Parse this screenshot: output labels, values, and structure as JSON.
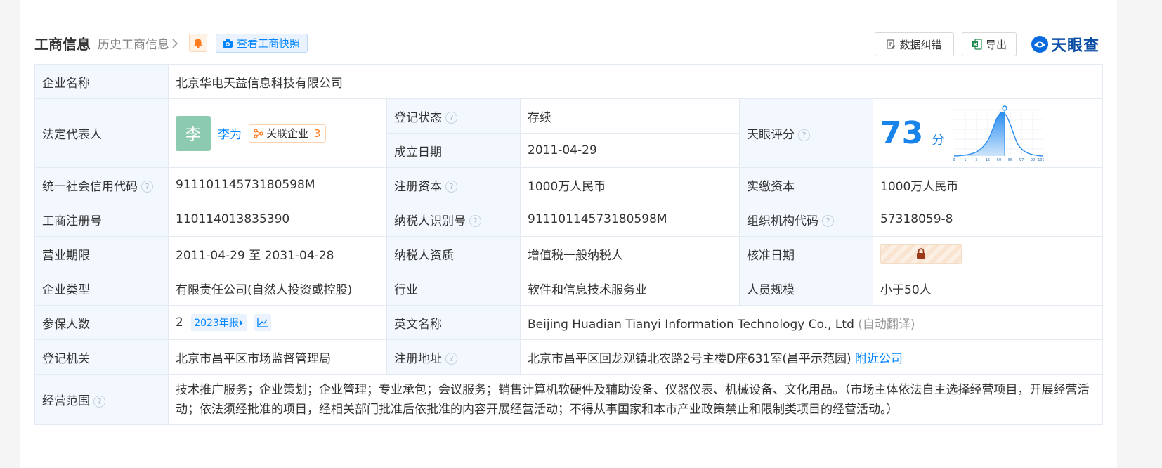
{
  "header": {
    "title": "工商信息",
    "history_label": "历史工商信息",
    "snapshot_label": "查看工商快照",
    "correct_label": "数据纠错",
    "export_label": "导出",
    "brand": "天眼查"
  },
  "company": {
    "name_label": "企业名称",
    "name": "北京华电天益信息科技有限公司",
    "rep_label": "法定代表人",
    "rep_avatar": "李",
    "rep_name": "李为",
    "related_label": "关联企业",
    "related_count": "3",
    "status_label": "登记状态",
    "status": "存续",
    "found_label": "成立日期",
    "found_date": "2011-04-29",
    "score_label": "天眼评分",
    "score": "73",
    "score_unit": "分",
    "score_ticks": [
      "0",
      "1",
      "3",
      "15",
      "50",
      "85",
      "97",
      "99",
      "100"
    ],
    "credit_label": "统一社会信用代码",
    "credit_code": "91110114573180598M",
    "capital_label": "注册资本",
    "capital": "1000万人民币",
    "paid_label": "实缴资本",
    "paid": "1000万人民币",
    "regno_label": "工商注册号",
    "regno": "110114013835390",
    "taxid_label": "纳税人识别号",
    "taxid": "91110114573180598M",
    "orgcode_label": "组织机构代码",
    "orgcode": "57318059-8",
    "term_label": "营业期限",
    "term": "2011-04-29 至 2031-04-28",
    "taxtype_label": "纳税人资质",
    "taxtype": "增值税一般纳税人",
    "approve_label": "核准日期",
    "type_label": "企业类型",
    "type": "有限责任公司(自然人投资或控股)",
    "industry_label": "行业",
    "industry": "软件和信息技术服务业",
    "staff_label": "人员规模",
    "staff": "小于50人",
    "insured_label": "参保人数",
    "insured": "2",
    "report_label": "2023年报",
    "english_label": "英文名称",
    "english": "Beijing Huadian Tianyi Information Technology Co., Ltd",
    "translate_note": "(自动翻译)",
    "authority_label": "登记机关",
    "authority": "北京市昌平区市场监督管理局",
    "address_label": "注册地址",
    "address": "北京市昌平区回龙观镇北农路2号主楼D座631室(昌平示范园)",
    "nearby_label": "附近公司",
    "scope_label": "经营范围",
    "scope": "技术推广服务；企业策划；企业管理；专业承包；会议服务；销售计算机软硬件及辅助设备、仪器仪表、机械设备、文化用品。（市场主体依法自主选择经营项目，开展经营活动；依法须经批准的项目，经相关部门批准后依批准的内容开展经营活动；不得从事国家和本市产业政策禁止和限制类项目的经营活动。）"
  },
  "colors": {
    "accent": "#0084ff",
    "status_green": "#19a15f",
    "label_bg": "#f2f8fd",
    "score_blue": "#1884ea"
  }
}
